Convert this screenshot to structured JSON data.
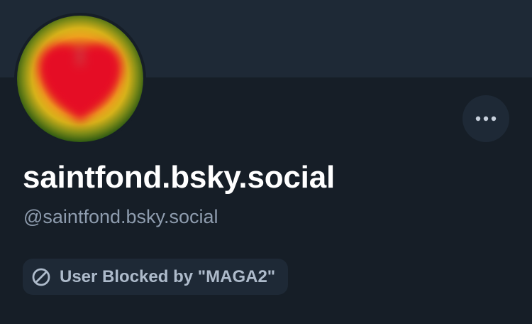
{
  "profile": {
    "display_name": "saintfond.bsky.social",
    "handle": "@saintfond.bsky.social",
    "avatar_icon": "heart-avatar-blurred"
  },
  "actions": {
    "more_icon": "ellipsis-icon"
  },
  "moderation": {
    "badge_icon": "block-icon",
    "badge_label": "User Blocked by \"MAGA2\""
  },
  "colors": {
    "background": "#161e27",
    "banner": "#1e2936",
    "handle_text": "#8e9cae",
    "badge_text": "#aebbcb"
  }
}
